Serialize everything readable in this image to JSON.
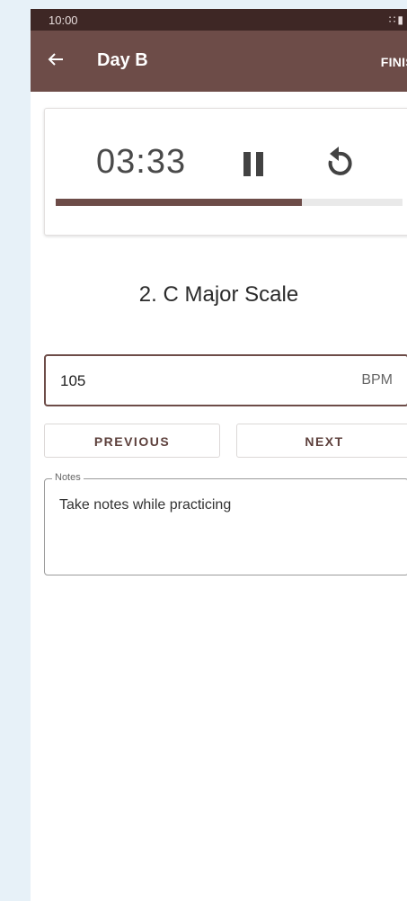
{
  "status_bar": {
    "time": "10:00",
    "icons": [
      "wifi-icon",
      "battery-icon"
    ]
  },
  "app_bar": {
    "back_icon": "arrow-left-icon",
    "title": "Day B",
    "action_label": "FINIS"
  },
  "timer": {
    "time": "03:33",
    "pause_icon": "pause-icon",
    "reset_icon": "reset-icon",
    "progress": 0.71
  },
  "exercise": {
    "title": "2. C Major Scale"
  },
  "bpm": {
    "value": "105",
    "unit": "BPM"
  },
  "nav": {
    "previous_label": "PREVIOUS",
    "next_label": "NEXT"
  },
  "notes": {
    "label": "Notes",
    "placeholder": "Take notes while practicing"
  },
  "colors": {
    "status_bar": "#3e2725",
    "app_bar": "#6d4c48",
    "accent": "#6d4c48",
    "page_background": "#e7f1f8"
  }
}
